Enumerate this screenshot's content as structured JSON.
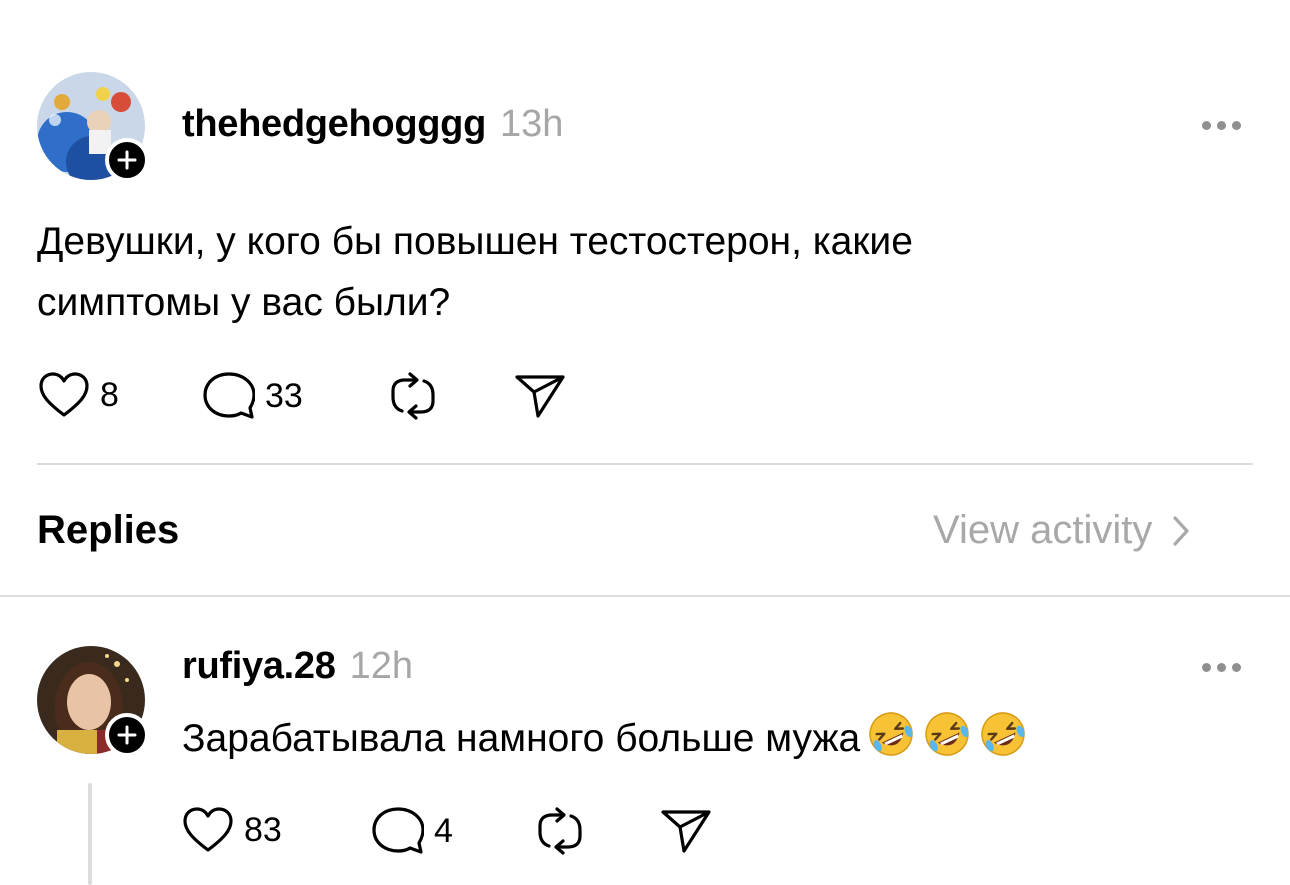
{
  "post": {
    "username": "thehedgehogggg",
    "time": "13h",
    "text_line1": "Девушки, у кого бы повышен тестостерон, какие",
    "text_line2": "симптомы у вас были?",
    "likes": "8",
    "comments": "33"
  },
  "replies_header": {
    "title": "Replies",
    "view_activity": "View activity"
  },
  "reply": {
    "username": "rufiya.28",
    "time": "12h",
    "text": "Зарабатывала намного больше мужа",
    "emoji_count": 3,
    "likes": "83",
    "comments": "4"
  },
  "icons": {
    "like": "heart-icon",
    "comment": "comment-bubble-icon",
    "repost": "repost-icon",
    "share": "send-icon",
    "more": "more-dots-icon",
    "follow": "plus-icon",
    "chevron": "chevron-right-icon",
    "emoji": "rolling-on-floor-laughing-emoji"
  }
}
